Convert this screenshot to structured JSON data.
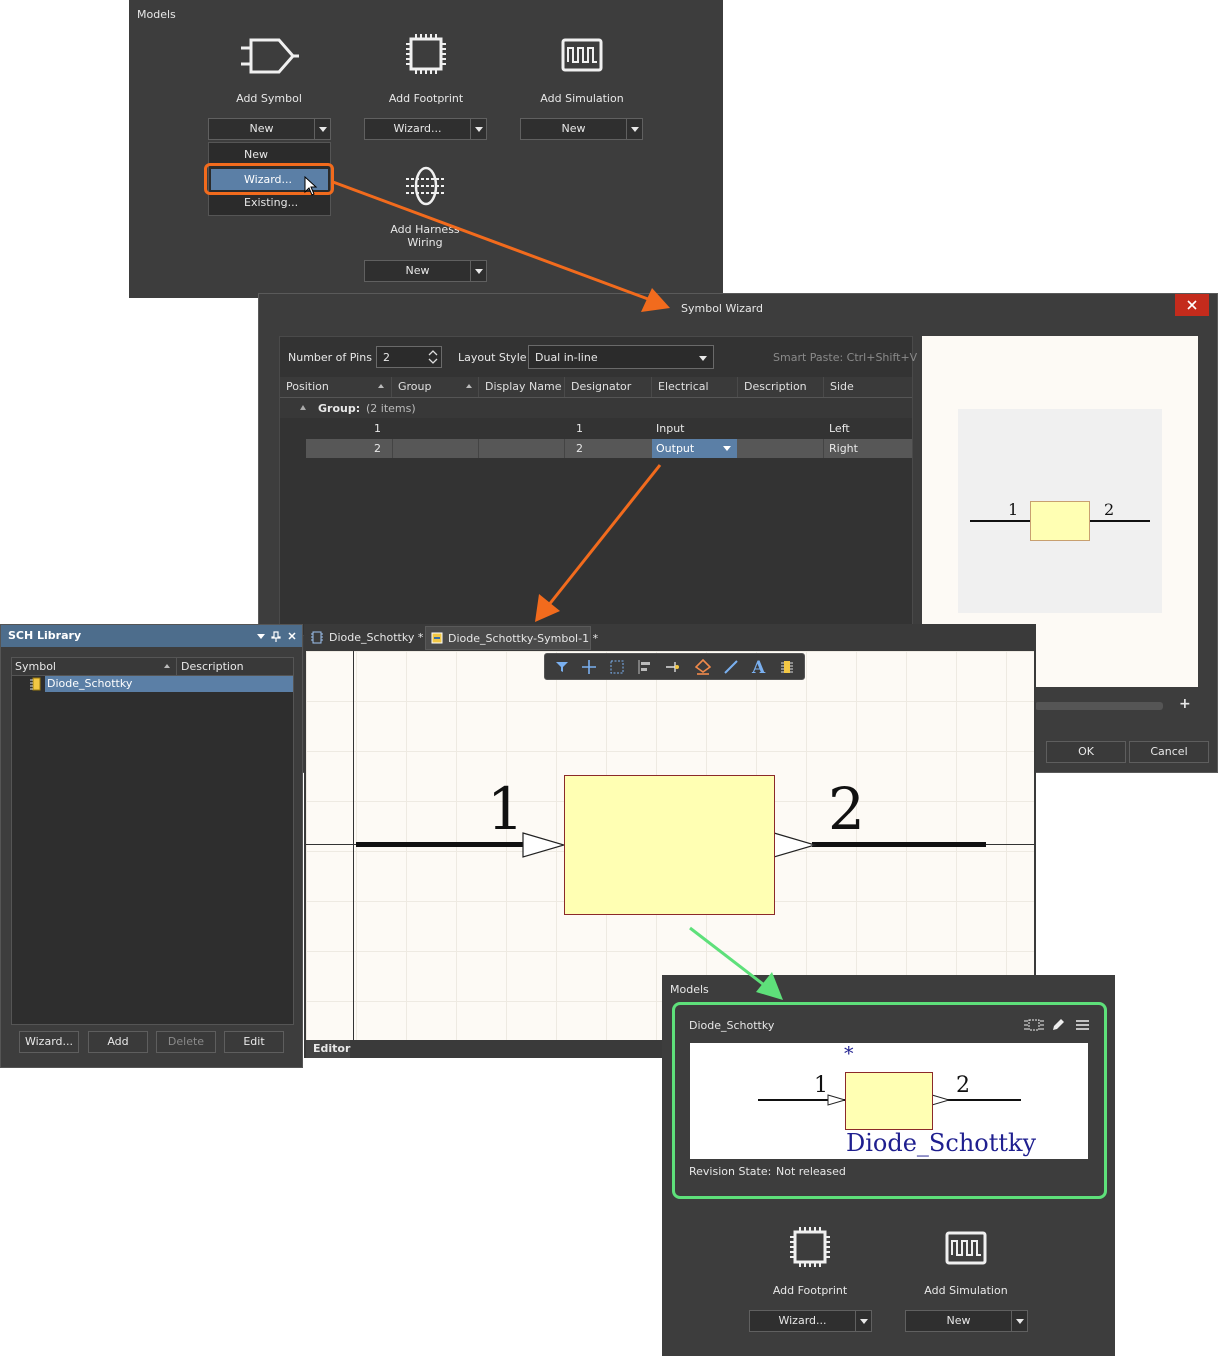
{
  "models_top": {
    "title": "Models",
    "items": [
      {
        "label": "Add Symbol",
        "button": "New",
        "icon": "symbol-gate-icon"
      },
      {
        "label": "Add Footprint",
        "button": "Wizard...",
        "icon": "footprint-chip-icon"
      },
      {
        "label": "Add Simulation",
        "button": "New",
        "icon": "simulation-wave-icon"
      },
      {
        "label": "Add Harness Wiring",
        "button": "New",
        "icon": "harness-wiring-icon"
      }
    ],
    "dropdown": [
      "New",
      "Wizard...",
      "Existing..."
    ]
  },
  "wizard": {
    "title": "Symbol Wizard",
    "pins_label": "Number of Pins",
    "pins_value": "2",
    "layout_label": "Layout Style",
    "layout_value": "Dual in-line",
    "smart_paste": "Smart Paste: Ctrl+Shift+V",
    "columns": [
      "Position",
      "Group",
      "Display Name",
      "Designator",
      "Electrical Type",
      "Description",
      "Side"
    ],
    "group_label": "Group:",
    "group_count": "(2 items)",
    "rows": [
      {
        "position": "1",
        "group": "",
        "display": "",
        "designator": "1",
        "type": "Input",
        "description": "",
        "side": "Left"
      },
      {
        "position": "2",
        "group": "",
        "display": "",
        "designator": "2",
        "type": "Output",
        "description": "",
        "side": "Right"
      }
    ],
    "preview_pin_left": "1",
    "preview_pin_right": "2",
    "ok": "OK",
    "cancel": "Cancel",
    "add": "+"
  },
  "library": {
    "title": "SCH Library",
    "col_symbol": "Symbol",
    "col_description": "Description",
    "item": "Diode_Schottky",
    "buttons": [
      "Wizard...",
      "Add",
      "Delete",
      "Edit"
    ]
  },
  "editor": {
    "tabs": [
      "Diode_Schottky *",
      "Diode_Schottky-Symbol-1 *"
    ],
    "pin_left": "1",
    "pin_right": "2",
    "bottom_tab": "Editor"
  },
  "models_bottom": {
    "title": "Models",
    "component": "Diode_Schottky",
    "star": "*",
    "pin_left": "1",
    "pin_right": "2",
    "symbol_name": "Diode_Schottky",
    "revision_label": "Revision State:",
    "revision_value": "Not released",
    "items": [
      {
        "label": "Add Footprint",
        "button": "Wizard..."
      },
      {
        "label": "Add Simulation",
        "button": "New"
      }
    ]
  },
  "colors": {
    "panel": "#3d3d3d",
    "accent_orange": "#f26b1d",
    "accent_green": "#5ee07a",
    "selection": "#5b7fa6",
    "symbol_fill": "#ffffb3"
  }
}
